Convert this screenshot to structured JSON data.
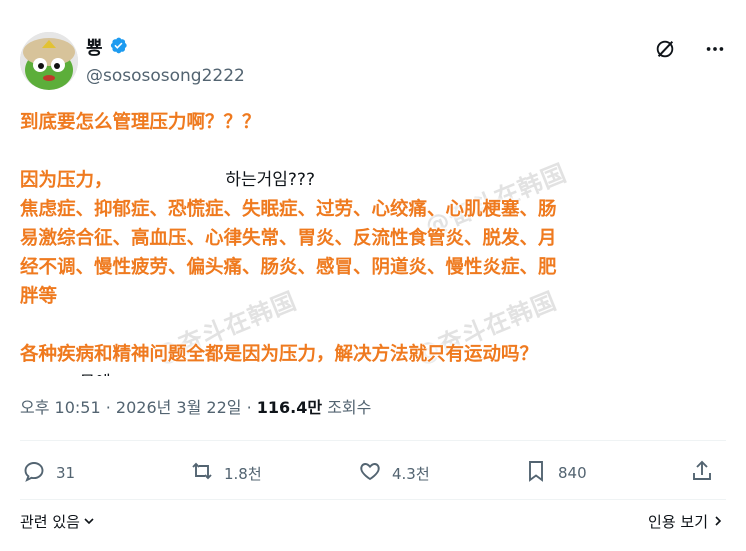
{
  "header": {
    "display_name": "뿅",
    "handle": "@sosososong2222"
  },
  "tweet": {
    "original_lines": [
      "                                      하는거임???",
      "",
      "           문에"
    ],
    "overlay_lines": [
      "到底要怎么管理压力啊？？？",
      "",
      "因为压力，",
      "焦虑症、抑郁症、恐慌症、失眠症、过劳、心绞痛、心肌梗塞、肠",
      "易激综合征、高血压、心律失常、胃炎、反流性食管炎、脱发、月",
      "经不调、慢性疲劳、偏头痛、肠炎、感冒、阴道炎、慢性炎症、肥",
      "胖等",
      "",
      "各种疾病和精神问题全都是因为压力，解决方法就只有运动吗？"
    ],
    "watermark": "@奋斗在韩国"
  },
  "meta": {
    "time": "오후 10:51",
    "separator1": " · ",
    "date": "2026년 3월 22일",
    "separator2": " · ",
    "views": "116.4만",
    "views_label": " 조회수"
  },
  "actions": {
    "replies": "31",
    "retweets": "1.8천",
    "likes": "4.3천",
    "bookmarks": "840"
  },
  "footer": {
    "related_label": "관련 있음",
    "quote_view_label": "인용 보기"
  },
  "colors": {
    "overlay_orange": "#ef7a1f",
    "verified_blue": "#1d9bf0",
    "secondary_text": "#536471"
  },
  "icons": [
    "grok-icon",
    "more-icon",
    "verified-icon",
    "reply-icon",
    "retweet-icon",
    "like-icon",
    "bookmark-icon",
    "share-icon",
    "chevron-down-icon",
    "chevron-right-icon"
  ]
}
